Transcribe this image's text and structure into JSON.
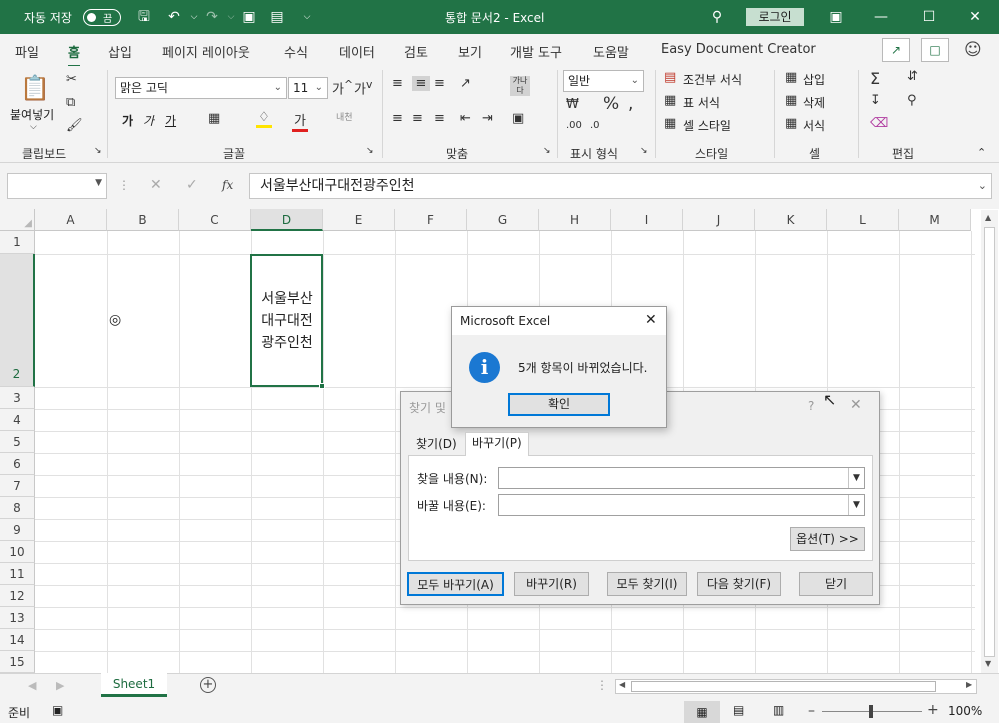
{
  "titlebar": {
    "autosave": "자동 저장",
    "toggle": "끔",
    "doc_title": "통합 문서2  -  Excel",
    "login": "로그인"
  },
  "menu": {
    "tabs": [
      "파일",
      "홈",
      "삽입",
      "페이지 레이아웃",
      "수식",
      "데이터",
      "검토",
      "보기",
      "개발 도구",
      "도움말",
      "Easy Document Creator"
    ]
  },
  "ribbon": {
    "clipboard": {
      "paste": "붙여넣기",
      "label": "클립보드"
    },
    "font": {
      "name": "맑은 고딕",
      "size": "11",
      "label": "글꼴",
      "bold": "가",
      "italic": "가",
      "underline": "가"
    },
    "align": {
      "label": "맞춤"
    },
    "number": {
      "format": "일반",
      "label": "표시 형식"
    },
    "style": {
      "cond": "조건부 서식",
      "table": "표 서식",
      "cell": "셀 스타일",
      "label": "스타일"
    },
    "cells": {
      "insert": "삽입",
      "delete": "삭제",
      "format": "서식",
      "label": "셀"
    },
    "edit": {
      "label": "편집"
    }
  },
  "formula_bar": {
    "fx": "fx",
    "value": "서울부산대구대전광주인천"
  },
  "grid": {
    "columns": [
      "A",
      "B",
      "C",
      "D",
      "E",
      "F",
      "G",
      "H",
      "I",
      "J",
      "K",
      "L",
      "M"
    ],
    "rows": [
      "1",
      "2",
      "3",
      "4",
      "5",
      "6",
      "7",
      "8",
      "9",
      "10",
      "11",
      "12",
      "13",
      "14",
      "15"
    ],
    "b2_symbol": "◎",
    "d2_lines": [
      "서울부산",
      "대구대전",
      "광주인천"
    ]
  },
  "sheetbar": {
    "tab": "Sheet1",
    "ready": "준비",
    "zoom": "100%"
  },
  "find_dialog": {
    "title": "찾기 및",
    "tab_find": "찾기(D)",
    "tab_replace": "바꾸기(P)",
    "find_label": "찾을 내용(N):",
    "replace_label": "바꿀 내용(E):",
    "options": "옵션(T) >>",
    "replace_all": "모두 바꾸기(A)",
    "replace": "바꾸기(R)",
    "find_all": "모두 찾기(I)",
    "find_next": "다음 찾기(F)",
    "close": "닫기"
  },
  "message_box": {
    "title": "Microsoft Excel",
    "text": "5개 항목이 바뀌었습니다.",
    "ok": "확인"
  }
}
